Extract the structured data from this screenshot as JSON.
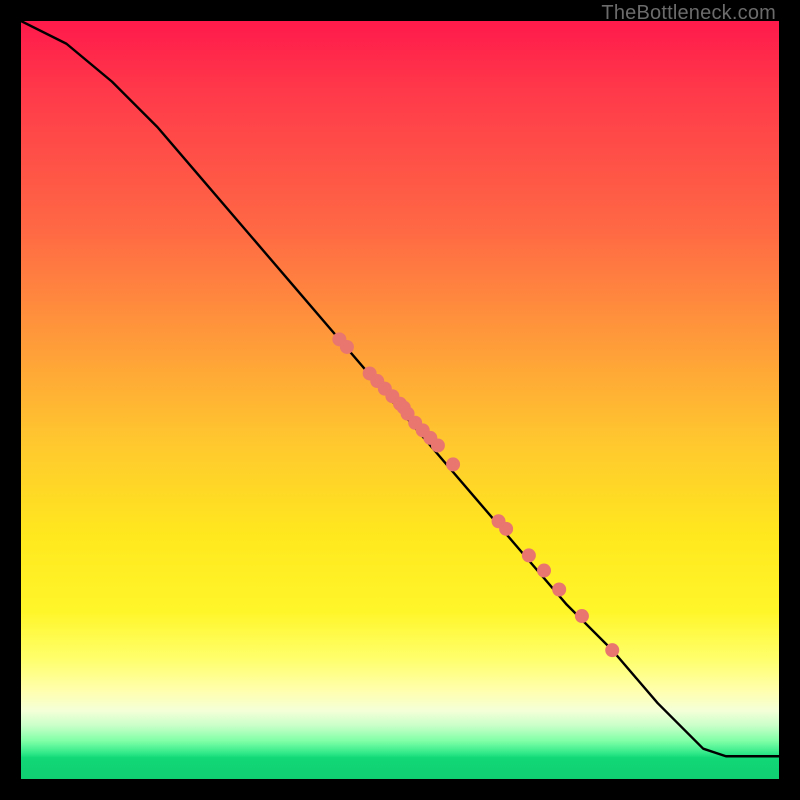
{
  "watermark": "TheBottleneck.com",
  "chart_data": {
    "type": "line",
    "title": "",
    "xlabel": "",
    "ylabel": "",
    "xlim": [
      0,
      100
    ],
    "ylim": [
      0,
      100
    ],
    "grid": false,
    "legend": false,
    "series": [
      {
        "name": "curve",
        "x": [
          0,
          6,
          12,
          18,
          24,
          30,
          36,
          42,
          48,
          54,
          60,
          66,
          72,
          78,
          84,
          90,
          93,
          100
        ],
        "y": [
          100,
          97,
          92,
          86,
          79,
          72,
          65,
          58,
          51,
          44,
          37,
          30,
          23,
          17,
          10,
          4,
          3,
          3
        ]
      }
    ],
    "points": {
      "name": "highlighted-points",
      "color": "#e9766f",
      "x": [
        42,
        43,
        46,
        47,
        48,
        49,
        50,
        50.5,
        51,
        52,
        53,
        54,
        55,
        57,
        63,
        64,
        67,
        69,
        71,
        74,
        78
      ],
      "y": [
        58,
        57,
        53.5,
        52.5,
        51.5,
        50.5,
        49.5,
        49,
        48.2,
        47,
        46,
        45,
        44,
        41.5,
        34,
        33,
        29.5,
        27.5,
        25,
        21.5,
        17
      ]
    }
  }
}
